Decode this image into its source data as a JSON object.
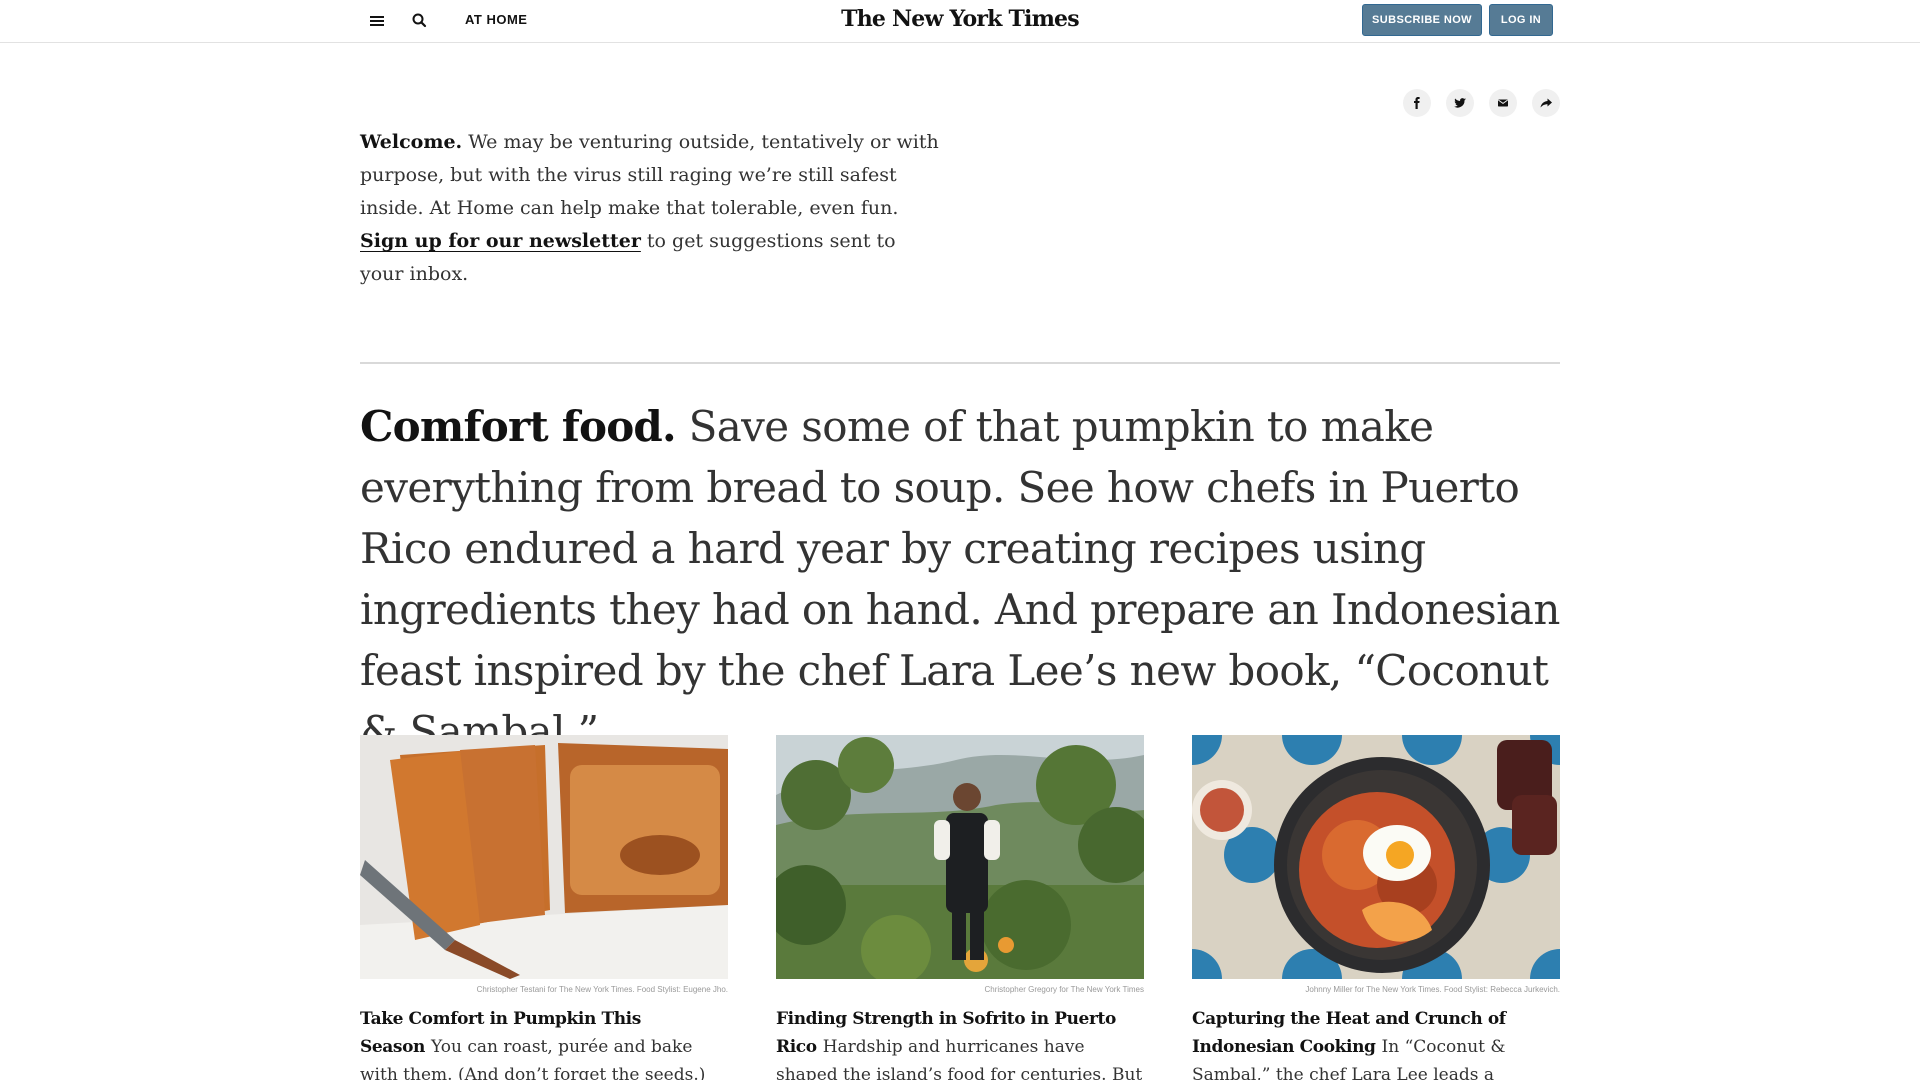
{
  "header": {
    "section": "AT HOME",
    "masthead": "The New York Times",
    "subscribe_label": "SUBSCRIBE NOW",
    "login_label": "LOG IN"
  },
  "share": {
    "icons": [
      "facebook-icon",
      "twitter-icon",
      "email-icon",
      "share-arrow-icon"
    ]
  },
  "intro": {
    "lead": "Welcome.",
    "body": " We may be venturing outside, tentatively or with purpose, but with the virus still raging we’re still safest inside. At Home can help make that tolerable, even fun. ",
    "link": "Sign up for our newsletter",
    "tail": " to get suggestions sent to your inbox."
  },
  "feature": {
    "lead": "Comfort food.",
    "body": " Save some of that pumpkin to make everything from bread to soup. See how chefs in Puerto Rico endured a hard year by creating recipes using ingredients they had on hand. And prepare an Indonesian feast inspired by the chef Lara Lee’s new book, “Coconut & Sambal.”"
  },
  "cards": [
    {
      "credit": "Christopher Testani for The New York Times. Food Stylist: Eugene Jho.",
      "headline": "Take Comfort in Pumpkin This Season",
      "summary": "You can roast, purée and bake with them. (And don’t forget the seeds.)"
    },
    {
      "credit": "Christopher Gregory for The New York Times",
      "headline": "Finding Strength in Sofrito in Puerto Rico",
      "summary": "Hardship and hurricanes have shaped the island’s food for centuries. But"
    },
    {
      "credit": "Johnny Miller for The New York Times. Food Stylist: Rebecca Jurkevich.",
      "headline": "Capturing the Heat and Crunch of Indonesian Cooking",
      "summary": "In “Coconut & Sambal,” the chef Lara Lee leads a culinary"
    }
  ],
  "colors": {
    "button_blue": "#567b95",
    "text": "#121212",
    "body_text": "#333333",
    "rule": "#d9d9d9"
  }
}
